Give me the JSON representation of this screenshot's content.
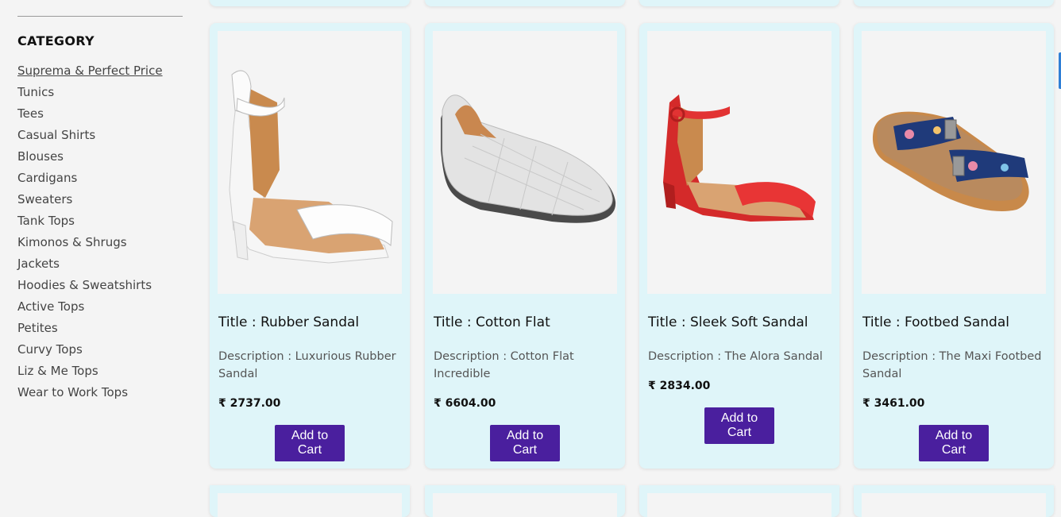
{
  "sidebar": {
    "heading": "CATEGORY",
    "items": [
      "Suprema & Perfect Price",
      "Tunics",
      "Tees",
      "Casual Shirts",
      "Blouses",
      "Cardigans",
      "Sweaters",
      "Tank Tops",
      "Kimonos & Shrugs",
      "Jackets",
      "Hoodies & Sweatshirts",
      "Active Tops",
      "Petites",
      "Curvy Tops",
      "Liz & Me Tops",
      "Wear to Work Tops"
    ]
  },
  "products": [
    {
      "title": "Title : Rubber Sandal",
      "description": "Description : Luxurious Rubber Sandal",
      "price": "₹ 2737.00",
      "cart_label": "Add to Cart",
      "image": "white-ankle-strap-sandal"
    },
    {
      "title": "Title : Cotton Flat",
      "description": "Description : Cotton Flat Incredible",
      "price": "₹ 6604.00",
      "cart_label": "Add to Cart",
      "image": "white-woven-flat-shoe"
    },
    {
      "title": "Title : Sleek Soft Sandal",
      "description": "Description : The Alora Sandal",
      "price": "₹ 2834.00",
      "cart_label": "Add to Cart",
      "image": "red-ankle-strap-sandal"
    },
    {
      "title": "Title : Footbed Sandal",
      "description": "Description : The Maxi Footbed Sandal",
      "price": "₹ 3461.00",
      "cart_label": "Add to Cart",
      "image": "floral-footbed-sandal"
    }
  ],
  "colors": {
    "card_bg": "#dff5f9",
    "button_bg": "#4a1f9e",
    "page_bg": "#f4f4f4"
  }
}
